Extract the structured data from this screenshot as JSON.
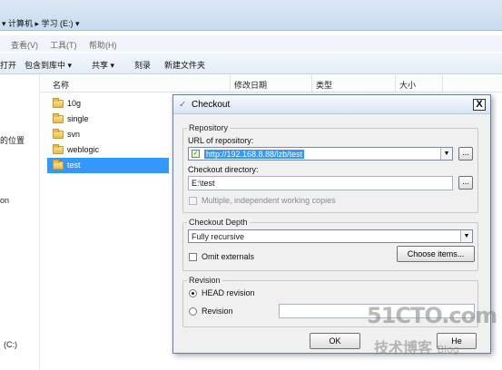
{
  "explorer": {
    "address_prefix": "▾ 计算机 ▸ 学习 (E:) ▾",
    "menu": [
      "查看(V)",
      "工具(T)",
      "帮助(H)"
    ],
    "toolbar": [
      "打开",
      "包含到库中 ▾",
      "共享 ▾",
      "刻录",
      "新建文件夹"
    ],
    "columns": [
      "名称",
      "修改日期",
      "类型",
      "大小"
    ],
    "nav_items": [
      "的位置",
      "on",
      "(C:)"
    ],
    "files": [
      {
        "name": "10g",
        "selected": false
      },
      {
        "name": "single",
        "selected": false
      },
      {
        "name": "svn",
        "selected": false
      },
      {
        "name": "weblogic",
        "selected": false
      },
      {
        "name": "test",
        "selected": true
      }
    ],
    "selection_color": "#3399ff"
  },
  "dialog": {
    "title": "Checkout",
    "close_label": "X",
    "repository": {
      "group_label": "Repository",
      "url_label": "URL of repository:",
      "url_value": "http://192.168.8.88/lzb/test",
      "checkout_dir_label": "Checkout directory:",
      "checkout_dir_value": "E:\\test",
      "browse_label": "...",
      "multiple_label": "Multiple, independent working copies",
      "multiple_checked": false
    },
    "depth": {
      "group_label": "Checkout Depth",
      "value": "Fully recursive",
      "omit_externals_label": "Omit externals",
      "omit_checked": false,
      "choose_items_label": "Choose items..."
    },
    "revision": {
      "group_label": "Revision",
      "head_label": "HEAD revision",
      "head_selected": true,
      "revision_label": "Revision",
      "revision_value": ""
    },
    "buttons": {
      "ok": "OK",
      "help": "He"
    }
  },
  "watermark": {
    "line1": "51CTO.com",
    "line2": "技术博客",
    "line2_suffix": "Blog"
  }
}
